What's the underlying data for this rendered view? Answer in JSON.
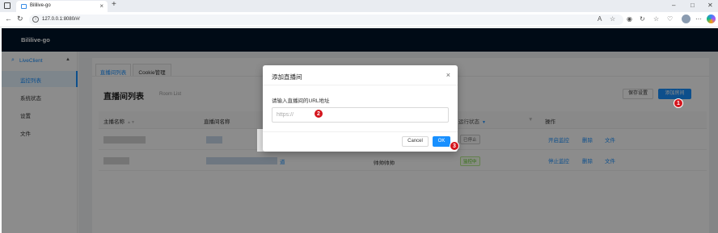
{
  "browser": {
    "tab_title": "Bililive-go",
    "tab_close": "×",
    "new_tab": "+",
    "url": "127.0.0.1:8080/#/",
    "back": "←",
    "refresh": "↻",
    "minimize": "–",
    "maximize": "□",
    "close": "✕"
  },
  "app": {
    "brand": "Bililive-go",
    "sidebar": {
      "group_label": "LiveClient",
      "items": [
        {
          "label": "监控列表"
        },
        {
          "label": "系统状态"
        },
        {
          "label": "设置"
        },
        {
          "label": "文件"
        }
      ]
    },
    "tabs": [
      {
        "label": "直播间列表"
      },
      {
        "label": "Cookie管理"
      }
    ],
    "list": {
      "title": "直播间列表",
      "subtitle": "Room List",
      "save_settings": "保存设置",
      "add_room": "添加房间"
    },
    "table": {
      "columns": [
        {
          "label": "主播名称"
        },
        {
          "label": "直播间名称"
        },
        {
          "label": "运行状态"
        },
        {
          "label": "操作"
        }
      ],
      "rows": [
        {
          "room_suffix": "",
          "status": "已停止",
          "actions": [
            "开启监控",
            "删除",
            "文件"
          ]
        },
        {
          "room_suffix": "道",
          "note": "帅帅帅帅",
          "status": "监控中",
          "actions": [
            "停止监控",
            "删除",
            "文件"
          ]
        }
      ]
    }
  },
  "modal": {
    "title": "添加直播间",
    "label": "请输入直播间的URL地址",
    "placeholder": "https://",
    "cancel": "Cancel",
    "ok": "OK",
    "close": "×"
  },
  "callouts": [
    "1",
    "2",
    "3"
  ]
}
